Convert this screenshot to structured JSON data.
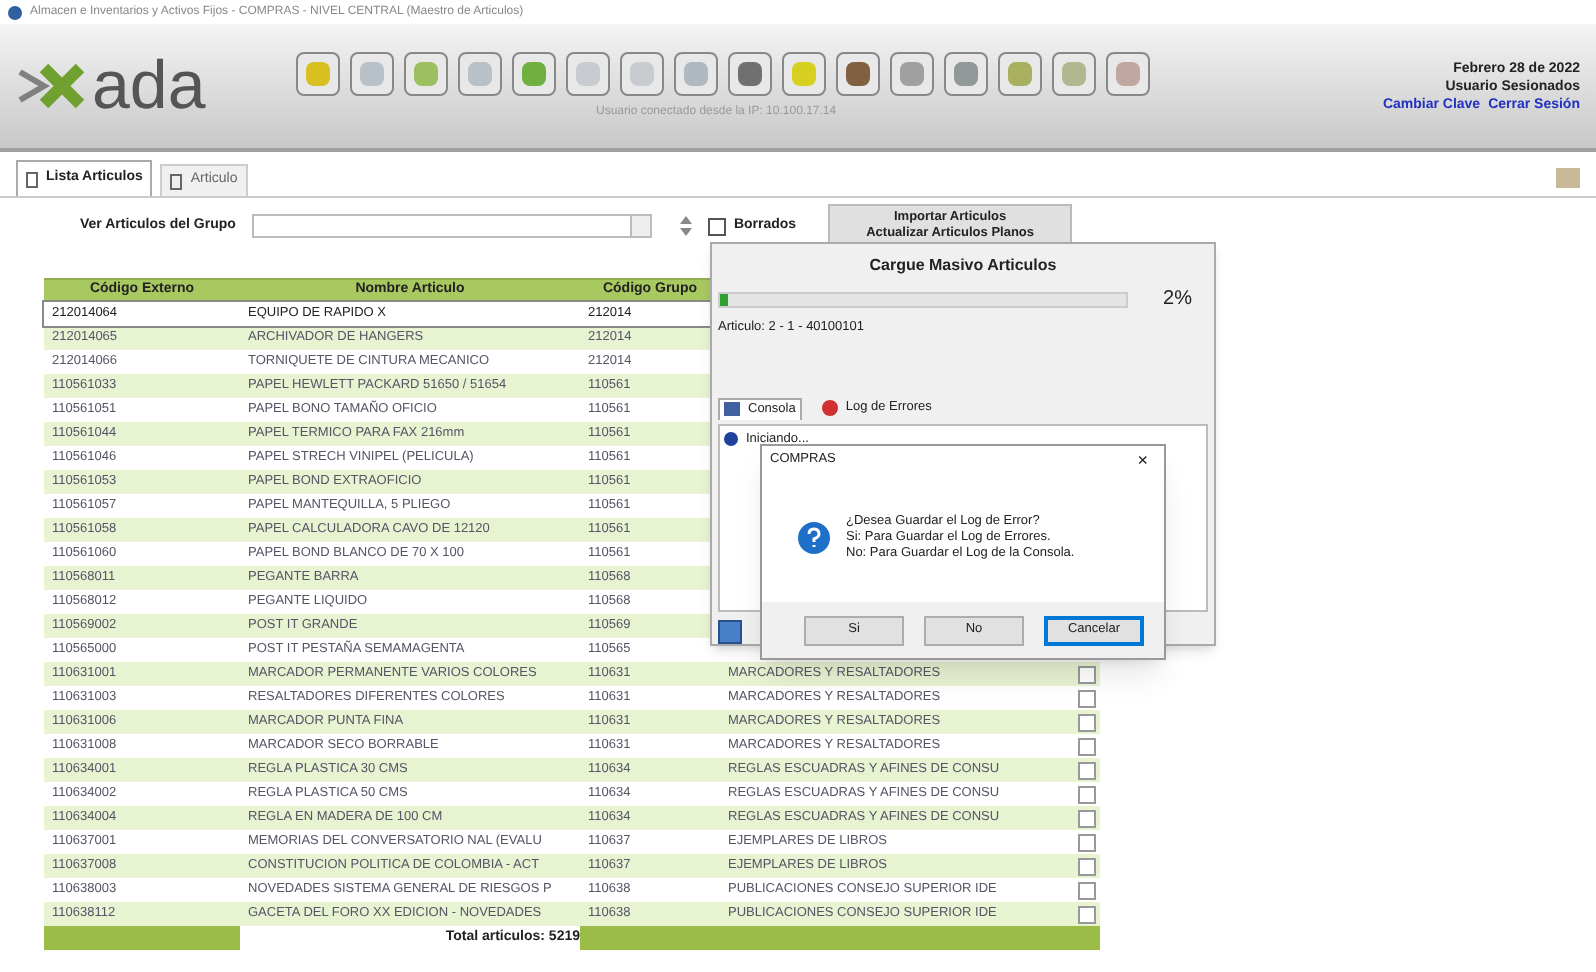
{
  "window": {
    "title": "Almacen e Inventarios y Activos Fijos - COMPRAS - NIVEL CENTRAL (Maestro de Articulos)"
  },
  "logo": {
    "text": "ada"
  },
  "header": {
    "connection": "Usuario conectado desde la IP: 10.100.17.14",
    "date": "Febrero 28 de 2022",
    "user": "Usuario Sesionados",
    "links": [
      "Cambiar Clave",
      "Cerrar Sesión"
    ]
  },
  "tabs": [
    {
      "label": "Lista Articulos",
      "selected": true
    },
    {
      "label": "Articulo",
      "selected": false
    }
  ],
  "filter": {
    "label": "Ver Articulos del Grupo",
    "checkbox": {
      "label": "Borrados",
      "checked": false
    },
    "buttons": [
      "Importar Articulos",
      "Actualizar Articulos Planos"
    ]
  },
  "table": {
    "columns": [
      "Código Externo",
      "Nombre Articulo",
      "Código Grupo"
    ],
    "rows": [
      {
        "cells": [
          "212014064",
          "EQUIPO DE RAPIDO X",
          "212014"
        ],
        "selected": true
      },
      {
        "cells": [
          "212014065",
          "ARCHIVADOR DE HANGERS",
          "212014"
        ],
        "selected": false
      },
      {
        "cells": [
          "212014066",
          "TORNIQUETE DE CINTURA MECANICO",
          "212014"
        ],
        "selected": false
      },
      {
        "cells": [
          "110561033",
          "PAPEL HEWLETT PACKARD 51650 / 51654",
          "110561"
        ],
        "selected": false
      },
      {
        "cells": [
          "110561051",
          "PAPEL BONO TAMAÑO OFICIO",
          "110561"
        ],
        "selected": false
      },
      {
        "cells": [
          "110561044",
          "PAPEL TERMICO PARA FAX 216mm",
          "110561"
        ],
        "selected": false
      },
      {
        "cells": [
          "110561046",
          "PAPEL STRECH VINIPEL (PELICULA)",
          "110561"
        ],
        "selected": false
      },
      {
        "cells": [
          "110561053",
          "PAPEL BOND EXTRAOFICIO",
          "110561"
        ],
        "selected": false
      },
      {
        "cells": [
          "110561057",
          "PAPEL MANTEQUILLA, 5 PLIEGO",
          "110561"
        ],
        "selected": false
      },
      {
        "cells": [
          "110561058",
          "PAPEL CALCULADORA CAVO DE 12120",
          "110561"
        ],
        "selected": false
      },
      {
        "cells": [
          "110561060",
          "PAPEL BOND BLANCO DE 70 X 100",
          "110561"
        ],
        "selected": false
      },
      {
        "cells": [
          "110568011",
          "PEGANTE BARRA",
          "110568"
        ],
        "selected": false
      },
      {
        "cells": [
          "110568012",
          "PEGANTE LIQUIDO",
          "110568"
        ],
        "selected": false
      },
      {
        "cells": [
          "110569002",
          "POST IT GRANDE",
          "110569"
        ],
        "selected": false
      },
      {
        "cells": [
          "110565000",
          "POST IT PESTAÑA SEMAMAGENTA",
          "110565"
        ],
        "selected": false
      },
      {
        "cells": [
          "110631001",
          "MARCADOR PERMANENTE VARIOS COLORES",
          "110631",
          "MARCADORES Y RESALTADORES"
        ],
        "selected": false,
        "checked": false
      },
      {
        "cells": [
          "110631003",
          "RESALTADORES DIFERENTES COLORES",
          "110631",
          "MARCADORES Y RESALTADORES"
        ],
        "selected": false,
        "checked": false
      },
      {
        "cells": [
          "110631006",
          "MARCADOR PUNTA FINA",
          "110631",
          "MARCADORES Y RESALTADORES"
        ],
        "selected": false,
        "checked": false
      },
      {
        "cells": [
          "110631008",
          "MARCADOR SECO BORRABLE",
          "110631",
          "MARCADORES Y RESALTADORES"
        ],
        "selected": false,
        "checked": false
      },
      {
        "cells": [
          "110634001",
          "REGLA PLASTICA 30 CMS",
          "110634",
          "REGLAS ESCUADRAS Y AFINES DE CONSU"
        ],
        "selected": false,
        "checked": false
      },
      {
        "cells": [
          "110634002",
          "REGLA PLASTICA 50 CMS",
          "110634",
          "REGLAS ESCUADRAS Y AFINES DE CONSU"
        ],
        "selected": false,
        "checked": false
      },
      {
        "cells": [
          "110634004",
          "REGLA EN MADERA DE 100 CM",
          "110634",
          "REGLAS ESCUADRAS Y AFINES DE CONSU"
        ],
        "selected": false,
        "checked": false
      },
      {
        "cells": [
          "110637001",
          "MEMORIAS DEL CONVERSATORIO NAL (EVALU",
          "110637",
          "EJEMPLARES DE LIBROS"
        ],
        "selected": false,
        "checked": false
      },
      {
        "cells": [
          "110637008",
          "CONSTITUCION POLITICA DE COLOMBIA - ACT",
          "110637",
          "EJEMPLARES DE LIBROS"
        ],
        "selected": false,
        "checked": false
      },
      {
        "cells": [
          "110638003",
          "NOVEDADES SISTEMA GENERAL DE RIESGOS P",
          "110638",
          "PUBLICACIONES CONSEJO SUPERIOR IDE"
        ],
        "selected": false,
        "checked": false
      },
      {
        "cells": [
          "110638112",
          "GACETA DEL FORO XX EDICION - NOVEDADES",
          "110638",
          "PUBLICACIONES CONSEJO SUPERIOR IDE"
        ],
        "selected": false,
        "checked": false
      }
    ],
    "total": "Total articulos: 5219"
  },
  "progress_dialog": {
    "title": "Cargue Masivo Articulos",
    "level": 0.02,
    "percent": "2%",
    "status": "Articulo: 2 - 1 - 40100101",
    "tabs": [
      {
        "label": "Consola",
        "selected": true
      },
      {
        "label": "Log de Errores",
        "selected": false
      }
    ],
    "console": [
      "Iniciando..."
    ]
  },
  "message_box": {
    "title": "COMPRAS",
    "close": "×",
    "lines": [
      "¿Desea Guardar el Log de Error?",
      "Si: Para Guardar el Log de Errores.",
      "No: Para Guardar el Log de la Consola."
    ],
    "buttons": [
      {
        "label": "Si",
        "selected": false
      },
      {
        "label": "No",
        "selected": false
      },
      {
        "label": "Cancelar",
        "selected": true
      }
    ]
  }
}
